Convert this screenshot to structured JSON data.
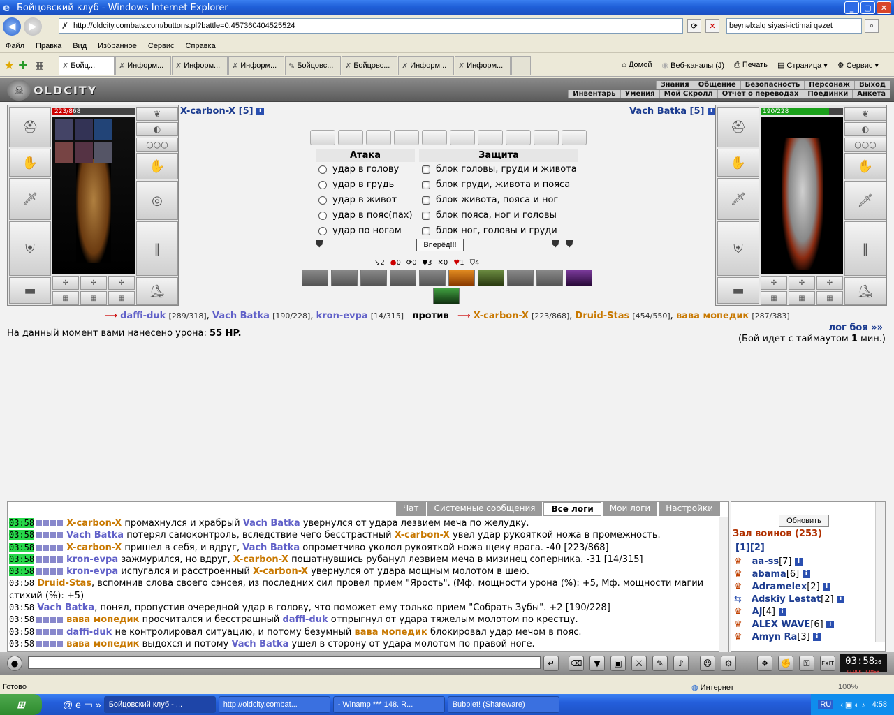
{
  "window": {
    "title": "Бойцовский клуб - Windows Internet Explorer"
  },
  "address": {
    "url": "http://oldcity.combats.com/buttons.pl?battle=0.457360404525524",
    "search": "beynəlxalq siyasi-ictimai qəzet"
  },
  "menu": [
    "Файл",
    "Правка",
    "Вид",
    "Избранное",
    "Сервис",
    "Справка"
  ],
  "tabs": [
    "Бойц...",
    "Информ...",
    "Информ...",
    "Информ...",
    "Бойцовс...",
    "Бойцовс...",
    "Информ...",
    "Информ..."
  ],
  "toolbar": {
    "home": "Домой",
    "feeds": "Веб-каналы (J)",
    "print": "Печать",
    "page": "Страница",
    "tools": "Сервис"
  },
  "game": {
    "logo": "OLDCITY",
    "nav_top": [
      "Знания",
      "Общение",
      "Безопасность",
      "Персонаж",
      "Выход"
    ],
    "nav_bottom": [
      "Инвентарь",
      "Умения",
      "Мой Скролл",
      "Отчет о переводах",
      "Поединки",
      "Анкета"
    ],
    "left_fighter": {
      "name": "X-carbon-X [5]",
      "hp": "223/868",
      "hp_fraction": 0.257
    },
    "right_fighter": {
      "name": "Vach Batka [5]",
      "hp": "190/228",
      "hp_fraction": 0.833
    },
    "attack_header": "Атака",
    "defense_header": "Защита",
    "attacks": [
      "удар в голову",
      "удар в грудь",
      "удар в живот",
      "удар в пояс(пах)",
      "удар по ногам"
    ],
    "defenses": [
      "блок головы, груди и живота",
      "блок груди, живота и пояса",
      "блок живота, пояса и ног",
      "блок пояса, ног и головы",
      "блок ног, головы и груди"
    ],
    "go_button": "Вперёд!!!",
    "stats": [
      "2",
      "0",
      "0",
      "3",
      "0",
      "1",
      "4"
    ],
    "team1": [
      {
        "n": "daffi-duk",
        "hp": "[289/318]"
      },
      {
        "n": "Vach Batka",
        "hp": "[190/228]"
      },
      {
        "n": "kron-evpa",
        "hp": "[14/315]"
      }
    ],
    "versus": "против",
    "team2": [
      {
        "n": "X-carbon-X",
        "hp": "[223/868]"
      },
      {
        "n": "Druid-Stas",
        "hp": "[454/550]"
      },
      {
        "n": "вава мопедик",
        "hp": "[287/383]"
      }
    ],
    "log_link": "лог боя »»",
    "damage_label": "На данный момент вами нанесено урона:",
    "damage_value": "55 HP.",
    "timeout_pre": "(Бой идет с таймаутом",
    "timeout_val": "1",
    "timeout_post": "мин.)"
  },
  "chat": {
    "tabs": [
      "Чат",
      "Системные сообщения",
      "Все логи",
      "Мои логи",
      "Настройки"
    ],
    "lines": [
      "03:58 X-carbon-X промахнулся и храбрый Vach Batka увернулся от удара лезвием меча по желудку.",
      "03:58 Vach Batka потерял самоконтроль, вследствие чего бесстрастный X-carbon-X увел удар рукояткой ножа в промежность.",
      "03:58 X-carbon-X пришел в себя, и вдруг, Vach Batka опрометчиво уколол рукояткой ножа щеку врага. -40 [223/868]",
      "03:58 kron-evpa зажмурился, но вдруг, X-carbon-X пошатнувшись рубанул лезвием меча в мизинец соперника. -31 [14/315]",
      "03:58 kron-evpa испугался и расстроенный X-carbon-X увернулся от удара мощным молотом в шею.",
      "03:58 Druid-Stas, вспомнив слова своего сэнсея, из последних сил провел прием \"Ярость\". (Мф. мощности урона (%): +5, Мф. мощности магии стихий (%): +5)",
      "03:58 Vach Batka, понял, пропустив очередной удар в голову, что поможет ему только прием \"Собрать Зубы\". +2 [190/228]",
      "03:58 вава мопедик просчитался и бесстрашный daffi-duk отпрыгнул от удара тяжелым молотом по крестцу.",
      "03:58 daffi-duk не контролировал ситуацию, и потому безумный вава мопедик блокировал удар мечом в пояс.",
      "03:58 вава мопедик выдохся и потому Vach Batka ушел в сторону от удара молотом по правой ноге."
    ]
  },
  "warriors": {
    "refresh": "Обновить",
    "header": "Зал воинов (253)",
    "pages": "[1][2]",
    "list": [
      {
        "name": "aa-ss",
        "lvl": "[7]"
      },
      {
        "name": "abama",
        "lvl": "[6]"
      },
      {
        "name": "Adramelex",
        "lvl": "[2]"
      },
      {
        "name": "Adskiy Lestat",
        "lvl": "[2]"
      },
      {
        "name": "AJ",
        "lvl": "[4]"
      },
      {
        "name": "ALEX WAVE",
        "lvl": "[6]"
      },
      {
        "name": "Amyn Ra",
        "lvl": "[3]"
      }
    ]
  },
  "clock": {
    "time": "03:58",
    "sec": "26",
    "label": "CLOCK TIMER"
  },
  "status": {
    "left": "Готово",
    "zone": "Интернет",
    "zoom": "100%"
  },
  "taskbar": {
    "items": [
      "Бойцовский клуб - ...",
      "http://oldcity.combat...",
      "- Winamp *** 148. R...",
      "Bubblet! (Shareware)"
    ],
    "lang": "RU",
    "time": "4:58"
  }
}
